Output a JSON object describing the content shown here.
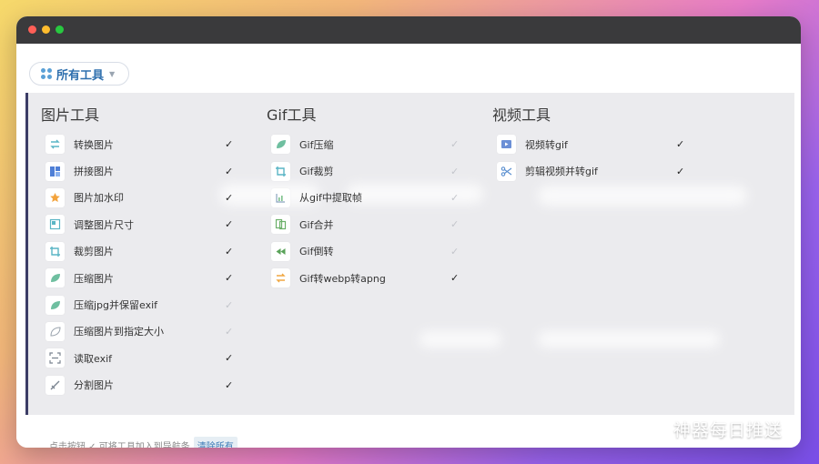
{
  "toolbar": {
    "label": "所有工具",
    "icon": "grid-icon"
  },
  "columns": [
    {
      "title": "图片工具",
      "items": [
        {
          "label": "转换图片",
          "icon": "convert-icon",
          "checked": true
        },
        {
          "label": "拼接图片",
          "icon": "collage-icon",
          "checked": true
        },
        {
          "label": "图片加水印",
          "icon": "watermark-icon",
          "checked": true
        },
        {
          "label": "调整图片尺寸",
          "icon": "resize-icon",
          "checked": true
        },
        {
          "label": "裁剪图片",
          "icon": "crop-icon",
          "checked": true
        },
        {
          "label": "压缩图片",
          "icon": "compress-icon",
          "checked": true
        },
        {
          "label": "压缩jpg并保留exif",
          "icon": "compress-icon",
          "checked": false
        },
        {
          "label": "压缩图片到指定大小",
          "icon": "compress-outline-icon",
          "checked": false
        },
        {
          "label": "读取exif",
          "icon": "scan-icon",
          "checked": true
        },
        {
          "label": "分割图片",
          "icon": "split-icon",
          "checked": true
        }
      ]
    },
    {
      "title": "Gif工具",
      "items": [
        {
          "label": "Gif压缩",
          "icon": "compress-icon",
          "checked": false
        },
        {
          "label": "Gif裁剪",
          "icon": "crop-icon",
          "checked": false
        },
        {
          "label": "从gif中提取帧",
          "icon": "frames-icon",
          "checked": false
        },
        {
          "label": "Gif合并",
          "icon": "merge-icon",
          "checked": false
        },
        {
          "label": "Gif倒转",
          "icon": "rewind-icon",
          "checked": false
        },
        {
          "label": "Gif转webp转apng",
          "icon": "convert-orange-icon",
          "checked": true
        }
      ]
    },
    {
      "title": "视频工具",
      "items": [
        {
          "label": "视频转gif",
          "icon": "video-play-icon",
          "checked": true
        },
        {
          "label": "剪辑视频并转gif",
          "icon": "scissors-icon",
          "checked": true
        }
      ]
    }
  ],
  "footer": {
    "hint": "点击按钮 ✓ 可将工具加入到导航条",
    "clear_label": "清除所有"
  },
  "watermark": {
    "text": "神器每日推送"
  },
  "colors": {
    "panel": "#ebebee",
    "accent": "#2e6fae",
    "titlebar": "#3a3a3c"
  }
}
